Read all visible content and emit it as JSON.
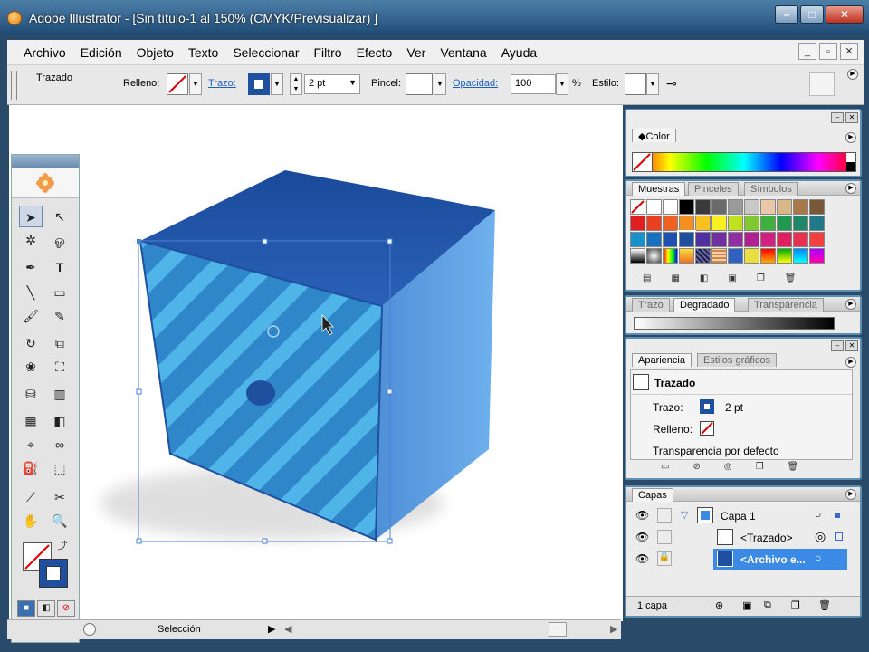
{
  "window": {
    "title": "Adobe Illustrator - [Sin título-1 al 150% (CMYK/Previsualizar) ]",
    "min_label": "–",
    "max_label": "□",
    "close_label": "✕"
  },
  "menu": {
    "items": [
      "Archivo",
      "Edición",
      "Objeto",
      "Texto",
      "Seleccionar",
      "Filtro",
      "Efecto",
      "Ver",
      "Ventana",
      "Ayuda"
    ],
    "doc_btns": [
      "_",
      "▫",
      "✕"
    ]
  },
  "control": {
    "object_label": "Trazado",
    "fill_label": "Relleno:",
    "stroke_label": "Trazo:",
    "stroke_weight": "2 pt",
    "brush_label": "Pincel:",
    "opacity_label": "Opacidad:",
    "opacity_value": "100",
    "opacity_unit": "%",
    "style_label": "Estilo:"
  },
  "colors": {
    "stroke_blue": "#1f4f9f",
    "selection": "#4a7fd6",
    "panel_border": "#5c8fb0",
    "highlight": "#3a8ae6"
  },
  "panels": {
    "color": {
      "tab": "Color"
    },
    "swatches": {
      "tabs": [
        "Muestras",
        "Pinceles",
        "Símbolos"
      ]
    },
    "gradient": {
      "tabs": [
        "Trazo",
        "Degradado",
        "Transparencia"
      ]
    },
    "appearance": {
      "tabs": [
        "Apariencia",
        "Estilos gráficos"
      ],
      "object": "Trazado",
      "stroke_label": "Trazo:",
      "stroke_value": "2 pt",
      "fill_label": "Relleno:",
      "transparency": "Transparencia por defecto"
    },
    "layers": {
      "tab": "Capas",
      "rows": [
        {
          "name": "Capa 1"
        },
        {
          "name": "<Trazado>"
        },
        {
          "name": "<Archivo e..."
        }
      ],
      "footer": "1 capa"
    }
  },
  "status": {
    "tool": "Selección"
  }
}
